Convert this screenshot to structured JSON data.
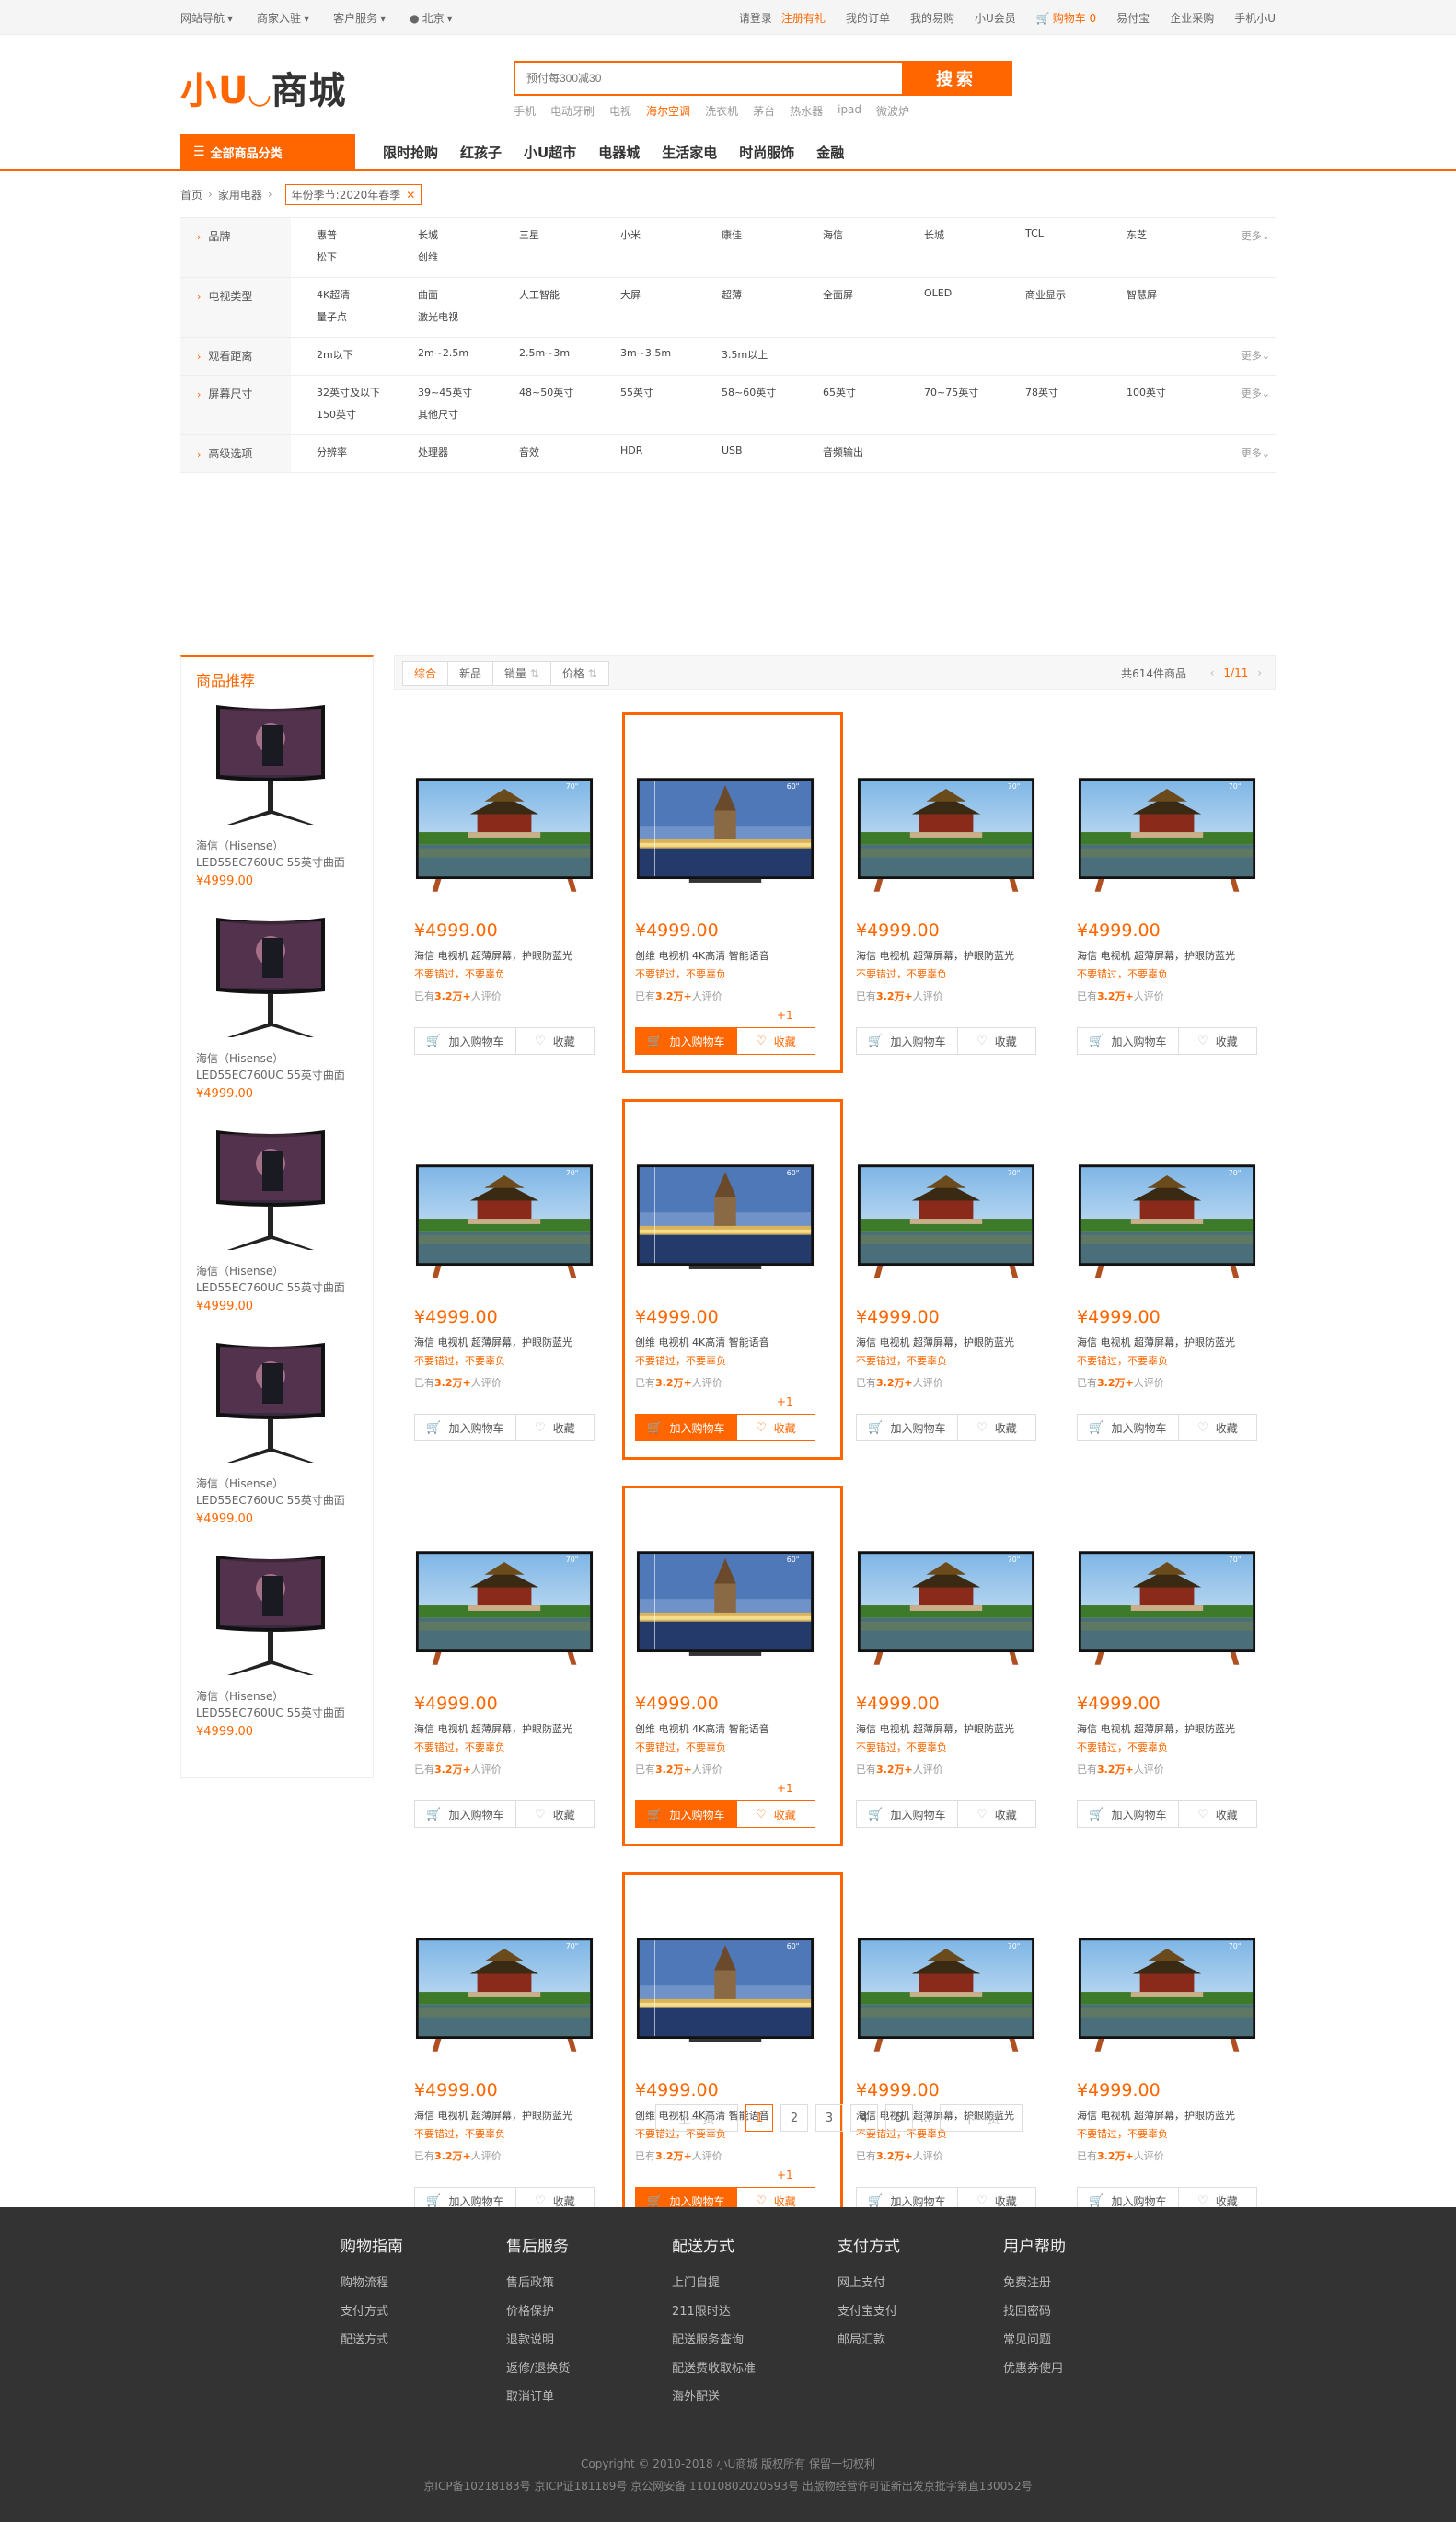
{
  "topbar": {
    "left": [
      "网站导航",
      "商家入驻",
      "客户服务"
    ],
    "city": "北京",
    "login": "请登录",
    "register": "注册有礼",
    "right": [
      "我的订单",
      "我的易购",
      "小U会员"
    ],
    "cart": "购物车 0",
    "right2": [
      "易付宝",
      "企业采购",
      "手机小U"
    ]
  },
  "logo": {
    "o": "小U",
    "smile": "◡",
    "k": "商城"
  },
  "search": {
    "placeholder": "预付每300减30",
    "button": "搜索",
    "hotwords": [
      "手机",
      "电动牙刷",
      "电视",
      "海尔空调",
      "洗衣机",
      "茅台",
      "热水器",
      "ipad",
      "微波炉"
    ]
  },
  "nav": {
    "allcat": "全部商品分类",
    "links": [
      "限时抢购",
      "红孩子",
      "小U超市",
      "电器城",
      "生活家电",
      "时尚服饰",
      "金融"
    ]
  },
  "crumb": {
    "home": "首页",
    "cat": "家用电器",
    "tag": "年份季节:2020年春季"
  },
  "filters": [
    {
      "label": "品牌",
      "vals": [
        "惠普",
        "长城",
        "三星",
        "小米",
        "康佳",
        "海信",
        "长城",
        "TCL",
        "东芝",
        "松下",
        "创维"
      ],
      "more": "更多"
    },
    {
      "label": "电视类型",
      "vals": [
        "4K超清",
        "曲面",
        "人工智能",
        "大屏",
        "超薄",
        "全面屏",
        "OLED",
        "商业显示",
        "智慧屏",
        "量子点",
        "激光电视"
      ],
      "more": ""
    },
    {
      "label": "观看距离",
      "vals": [
        "2m以下",
        "2m~2.5m",
        "2.5m~3m",
        "3m~3.5m",
        "3.5m以上"
      ],
      "more": "更多"
    },
    {
      "label": "屏幕尺寸",
      "vals": [
        "32英寸及以下",
        "39~45英寸",
        "48~50英寸",
        "55英寸",
        "58~60英寸",
        "65英寸",
        "70~75英寸",
        "78英寸",
        "100英寸",
        "150英寸",
        "其他尺寸"
      ],
      "more": "更多"
    },
    {
      "label": "高级选项",
      "vals": [
        "分辨率",
        "处理器",
        "音效",
        "HDR",
        "USB",
        "音频输出"
      ],
      "more": "更多"
    }
  ],
  "side": {
    "title": "商品推荐",
    "items": [
      {
        "name": "海信（Hisense）LED55EC760UC 55英寸曲面",
        "price": "¥4999.00"
      },
      {
        "name": "海信（Hisense）LED55EC760UC 55英寸曲面",
        "price": "¥4999.00"
      },
      {
        "name": "海信（Hisense）LED55EC760UC 55英寸曲面",
        "price": "¥4999.00"
      },
      {
        "name": "海信（Hisense）LED55EC760UC 55英寸曲面",
        "price": "¥4999.00"
      },
      {
        "name": "海信（Hisense）LED55EC760UC 55英寸曲面",
        "price": "¥4999.00"
      }
    ]
  },
  "sort": {
    "buttons": [
      "综合",
      "新品",
      "销量",
      "价格"
    ],
    "total": "共614件商品",
    "page": "1/11"
  },
  "product_a": {
    "price": "¥4999.00",
    "desc": "海信 电视机 超薄屏幕，护眼防蓝光",
    "sub": "不要错过，不要辜负",
    "rev_pre": "已有",
    "rev_num": "3.2万+",
    "rev_post": "人评价",
    "cart": "加入购物车",
    "fav": "收藏",
    "badge": "70\""
  },
  "product_b": {
    "price": "¥4999.00",
    "desc": "创维 电视机 4K高清 智能语音",
    "sub": "不要错过，不要辜负",
    "rev_pre": "已有",
    "rev_num": "3.2万+",
    "rev_post": "人评价",
    "plus": "+1",
    "cart": "加入购物车",
    "fav": "收藏",
    "badge": "60\""
  },
  "pagination": {
    "prev": "上一页",
    "pages": [
      "1",
      "2",
      "3",
      "4",
      "5"
    ],
    "dots": "...",
    "next": "下一页"
  },
  "footer": {
    "cols": [
      {
        "title": "购物指南",
        "items": [
          "购物流程",
          "支付方式",
          "配送方式"
        ]
      },
      {
        "title": "售后服务",
        "items": [
          "售后政策",
          "价格保护",
          "退款说明",
          "返修/退换货",
          "取消订单"
        ]
      },
      {
        "title": "配送方式",
        "items": [
          "上门自提",
          "211限时达",
          "配送服务查询",
          "配送费收取标准",
          "海外配送"
        ]
      },
      {
        "title": "支付方式",
        "items": [
          "网上支付",
          "支付宝支付",
          "邮局汇款"
        ]
      },
      {
        "title": "用户帮助",
        "items": [
          "免费注册",
          "找回密码",
          "常见问题",
          "优惠券使用"
        ]
      }
    ],
    "copyright": "Copyright © 2010-2018 小U商城 版权所有 保留一切权利",
    "icp": "京ICP备10218183号 京ICP证181189号 京公网安备 11010802020593号 出版物经营许可证新出发京批字第直130052号"
  },
  "colors": {
    "accent": "#ff6600",
    "footer_bg": "#333333"
  }
}
